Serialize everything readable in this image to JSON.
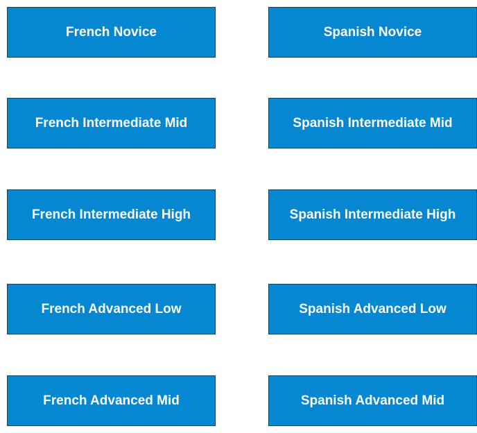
{
  "accent_color": "#0687d2",
  "border_color": "#1f3f55",
  "text_color": "#ffffff",
  "courses": {
    "french": [
      {
        "label": "French Novice"
      },
      {
        "label": "French Intermediate Mid"
      },
      {
        "label": "French Intermediate High"
      },
      {
        "label": "French Advanced Low"
      },
      {
        "label": "French Advanced Mid"
      }
    ],
    "spanish": [
      {
        "label": "Spanish Novice"
      },
      {
        "label": "Spanish Intermediate Mid"
      },
      {
        "label": "Spanish Intermediate High"
      },
      {
        "label": "Spanish Advanced Low"
      },
      {
        "label": "Spanish Advanced Mid"
      }
    ]
  }
}
